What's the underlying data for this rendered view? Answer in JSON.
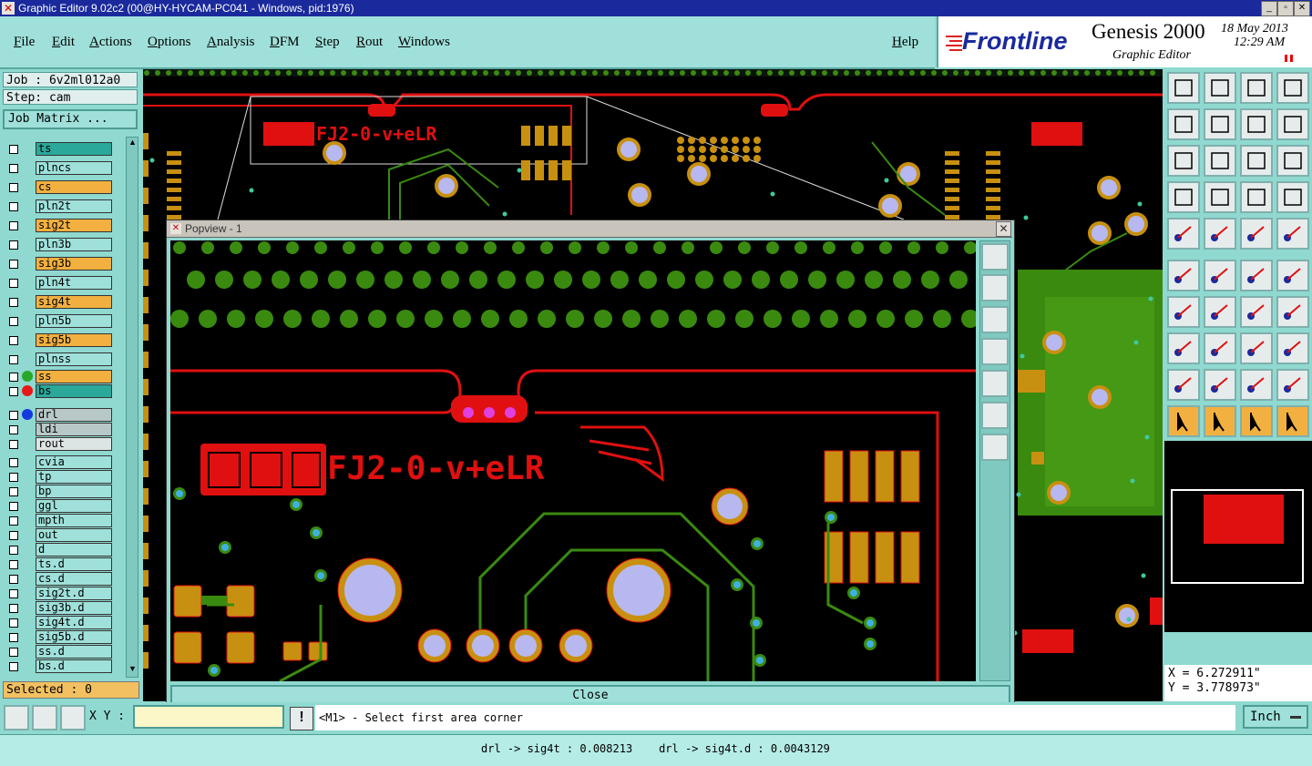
{
  "window": {
    "title": "Graphic Editor 9.02c2 (00@HY-HYCAM-PC041 - Windows, pid:1976)"
  },
  "menu": [
    "File",
    "Edit",
    "Actions",
    "Options",
    "Analysis",
    "DFM",
    "Step",
    "Rout",
    "Windows"
  ],
  "help": "Help",
  "logo": {
    "brand": "Frontline",
    "product": "Genesis 2000",
    "subtitle": "Graphic Editor",
    "date": "18 May 2013",
    "time": "12:29 AM"
  },
  "job": {
    "job_label": "Job : 6v2ml012a0",
    "step_label": "Step: cam",
    "matrix_button": "Job Matrix ..."
  },
  "layers": [
    {
      "name": "ts",
      "color": "#2aa89a",
      "dot": ""
    },
    {
      "name": "plncs",
      "color": "#9fe0da",
      "dot": ""
    },
    {
      "name": "cs",
      "color": "#f2b040",
      "dot": ""
    },
    {
      "name": "pln2t",
      "color": "#9fe0da",
      "dot": ""
    },
    {
      "name": "sig2t",
      "color": "#f2b040",
      "dot": ""
    },
    {
      "name": "pln3b",
      "color": "#9fe0da",
      "dot": ""
    },
    {
      "name": "sig3b",
      "color": "#f2b040",
      "dot": ""
    },
    {
      "name": "pln4t",
      "color": "#9fe0da",
      "dot": ""
    },
    {
      "name": "sig4t",
      "color": "#f2b040",
      "dot": ""
    },
    {
      "name": "pln5b",
      "color": "#9fe0da",
      "dot": ""
    },
    {
      "name": "sig5b",
      "color": "#f2b040",
      "dot": ""
    },
    {
      "name": "plnss",
      "color": "#9fe0da",
      "dot": ""
    },
    {
      "name": "ss",
      "color": "#f2b040",
      "dot": "#28a828"
    },
    {
      "name": "bs",
      "color": "#2aa89a",
      "dot": "#e81818"
    },
    {
      "name": "drl",
      "color": "#b8c8c8",
      "dot": "#1438e0"
    },
    {
      "name": "ldi",
      "color": "#b8c8c8",
      "dot": ""
    },
    {
      "name": "rout",
      "color": "#dde4e4",
      "dot": ""
    },
    {
      "name": "cvia",
      "color": "#9fe0da",
      "dot": ""
    },
    {
      "name": "tp",
      "color": "#9fe0da",
      "dot": ""
    },
    {
      "name": "bp",
      "color": "#9fe0da",
      "dot": ""
    },
    {
      "name": "ggl",
      "color": "#9fe0da",
      "dot": ""
    },
    {
      "name": "mpth",
      "color": "#9fe0da",
      "dot": ""
    },
    {
      "name": "out",
      "color": "#9fe0da",
      "dot": ""
    },
    {
      "name": "d",
      "color": "#9fe0da",
      "dot": ""
    },
    {
      "name": "ts.d",
      "color": "#9fe0da",
      "dot": ""
    },
    {
      "name": "cs.d",
      "color": "#9fe0da",
      "dot": ""
    },
    {
      "name": "sig2t.d",
      "color": "#9fe0da",
      "dot": ""
    },
    {
      "name": "sig3b.d",
      "color": "#9fe0da",
      "dot": ""
    },
    {
      "name": "sig4t.d",
      "color": "#9fe0da",
      "dot": ""
    },
    {
      "name": "sig5b.d",
      "color": "#9fe0da",
      "dot": ""
    },
    {
      "name": "ss.d",
      "color": "#9fe0da",
      "dot": ""
    },
    {
      "name": "bs.d",
      "color": "#9fe0da",
      "dot": ""
    }
  ],
  "selected": "Selected : 0",
  "popup": {
    "title": "Popview - 1",
    "close": "Close"
  },
  "pcb_text": "FJ2-0-v+eLR",
  "coords": {
    "x": "X = 6.272911\"",
    "y": "Y = 3.778973\""
  },
  "bottom": {
    "xy_label": "X Y :",
    "xy_value": "",
    "prompt": "<M1> - Select first area corner",
    "unit": "Inch"
  },
  "status": "drl -> sig4t : 0.008213    drl -> sig4t.d : 0.0043129"
}
